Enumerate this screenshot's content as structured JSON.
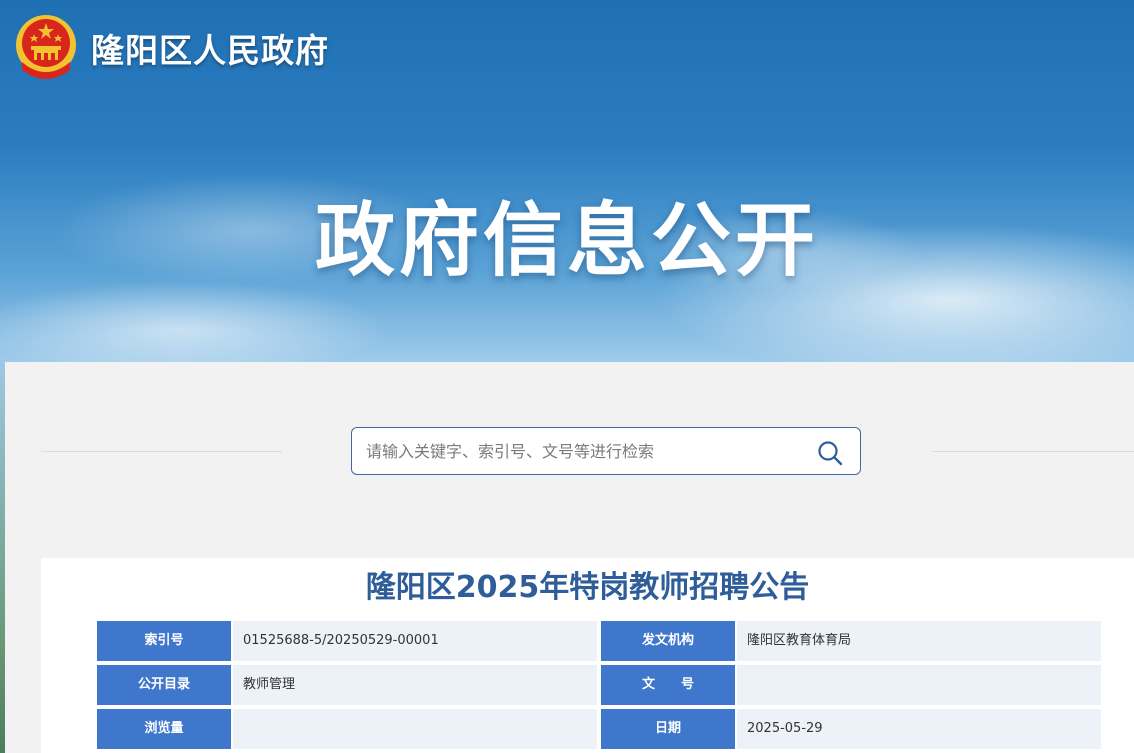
{
  "header": {
    "site_name": "隆阳区人民政府",
    "banner_title": "政府信息公开"
  },
  "search": {
    "placeholder": "请输入关键字、索引号、文号等进行检索",
    "value": ""
  },
  "article": {
    "title": "隆阳区2025年特岗教师招聘公告",
    "meta": [
      {
        "label": "索引号",
        "value": "01525688-5/20250529-00001",
        "label2": "发文机构",
        "value2": "隆阳区教育体育局"
      },
      {
        "label": "公开目录",
        "value": "教师管理",
        "label2": "文　　号",
        "value2": ""
      },
      {
        "label": "浏览量",
        "value": "",
        "label2": "日期",
        "value2": "2025-05-29"
      }
    ]
  },
  "colors": {
    "title_blue": "#2e5d9a",
    "label_blue": "#3f77cc",
    "value_bg": "#edf1f8",
    "emblem_red": "#d8261c",
    "emblem_gold": "#f2c230"
  },
  "icons": {
    "emblem": "national-emblem-icon",
    "search": "search-icon"
  }
}
